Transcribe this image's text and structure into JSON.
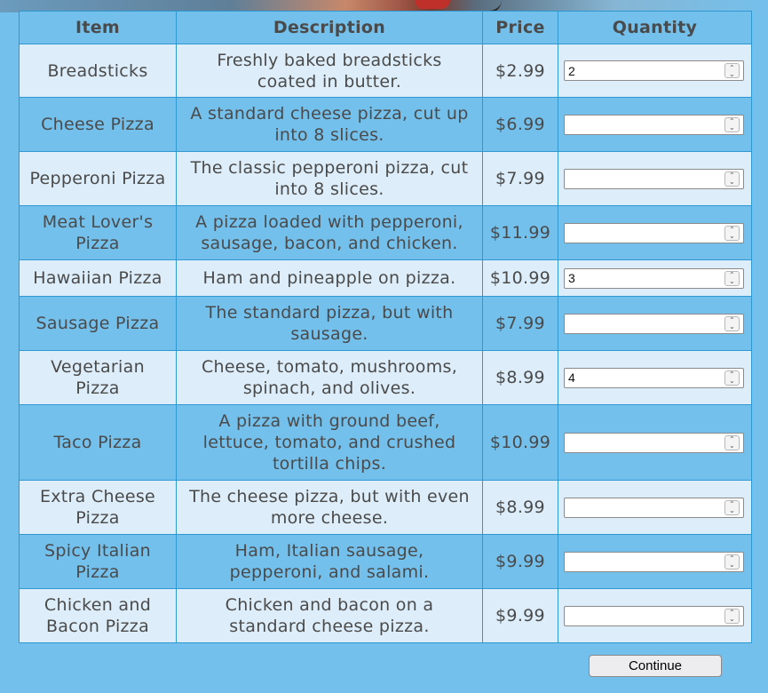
{
  "table": {
    "headers": {
      "item": "Item",
      "description": "Description",
      "price": "Price",
      "quantity": "Quantity"
    },
    "rows": [
      {
        "item": [
          "Breadsticks"
        ],
        "description": [
          "Freshly baked breadsticks",
          "coated in butter."
        ],
        "price": "$2.99",
        "quantity": "2"
      },
      {
        "item": [
          "Cheese Pizza"
        ],
        "description": [
          "A standard cheese pizza, cut up",
          "into 8 slices."
        ],
        "price": "$6.99",
        "quantity": ""
      },
      {
        "item": [
          "Pepperoni Pizza"
        ],
        "description": [
          "The classic pepperoni pizza, cut",
          "into 8 slices."
        ],
        "price": "$7.99",
        "quantity": ""
      },
      {
        "item": [
          "Meat Lover's",
          "Pizza"
        ],
        "description": [
          "A pizza loaded with pepperoni,",
          "sausage, bacon, and chicken."
        ],
        "price": "$11.99",
        "quantity": ""
      },
      {
        "item": [
          "Hawaiian Pizza"
        ],
        "description": [
          "Ham and pineapple on pizza."
        ],
        "price": "$10.99",
        "quantity": "3"
      },
      {
        "item": [
          "Sausage Pizza"
        ],
        "description": [
          "The standard pizza, but with",
          "sausage."
        ],
        "price": "$7.99",
        "quantity": ""
      },
      {
        "item": [
          "Vegetarian",
          "Pizza"
        ],
        "description": [
          "Cheese, tomato, mushrooms,",
          "spinach, and olives."
        ],
        "price": "$8.99",
        "quantity": "4"
      },
      {
        "item": [
          "Taco Pizza"
        ],
        "description": [
          "A pizza with ground beef,",
          "lettuce, tomato, and crushed",
          "tortilla chips."
        ],
        "price": "$10.99",
        "quantity": ""
      },
      {
        "item": [
          "Extra Cheese",
          "Pizza"
        ],
        "description": [
          "The cheese pizza, but with even",
          "more cheese."
        ],
        "price": "$8.99",
        "quantity": ""
      },
      {
        "item": [
          "Spicy Italian",
          "Pizza"
        ],
        "description": [
          "Ham, Italian sausage,",
          "pepperoni, and salami."
        ],
        "price": "$9.99",
        "quantity": ""
      },
      {
        "item": [
          "Chicken and",
          "Bacon Pizza"
        ],
        "description": [
          "Chicken and bacon on a",
          "standard cheese pizza."
        ],
        "price": "$9.99",
        "quantity": ""
      }
    ]
  },
  "continue_label": "Continue",
  "colors": {
    "background": "#74c0ec",
    "row_light": "#ddeefa",
    "border": "#2f98d0"
  },
  "icons": {
    "spinner": "up-down-chevron-icon"
  }
}
